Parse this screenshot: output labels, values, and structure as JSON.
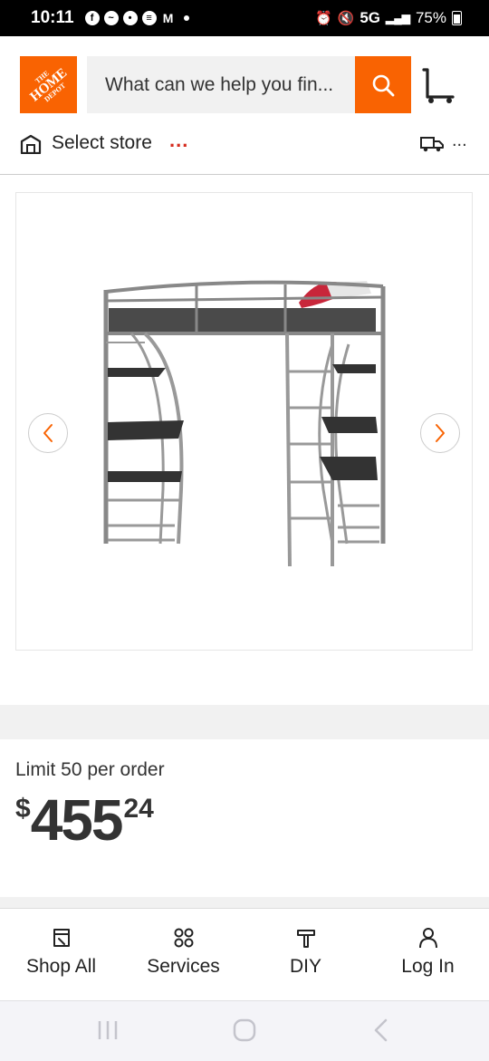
{
  "status_bar": {
    "time": "10:11",
    "network": "5G",
    "battery": "75%"
  },
  "brand": {
    "logo_top": "THE",
    "logo_main": "HOME",
    "logo_bottom": "DEPOT",
    "accent": "#f96302"
  },
  "search": {
    "placeholder": "What can we help you fin..."
  },
  "store": {
    "label": "Select store",
    "indicator": "...",
    "delivery_indicator": "..."
  },
  "product": {
    "image_icon": "loft-bed-product-image"
  },
  "purchase": {
    "limit_text": "Limit 50 per order",
    "currency": "$",
    "price_dollars": "455",
    "price_cents": "24"
  },
  "bottom_nav": {
    "items": [
      {
        "label": "Shop All",
        "icon": "shop-all-icon"
      },
      {
        "label": "Services",
        "icon": "services-icon"
      },
      {
        "label": "DIY",
        "icon": "diy-icon"
      },
      {
        "label": "Log In",
        "icon": "user-icon"
      }
    ]
  }
}
